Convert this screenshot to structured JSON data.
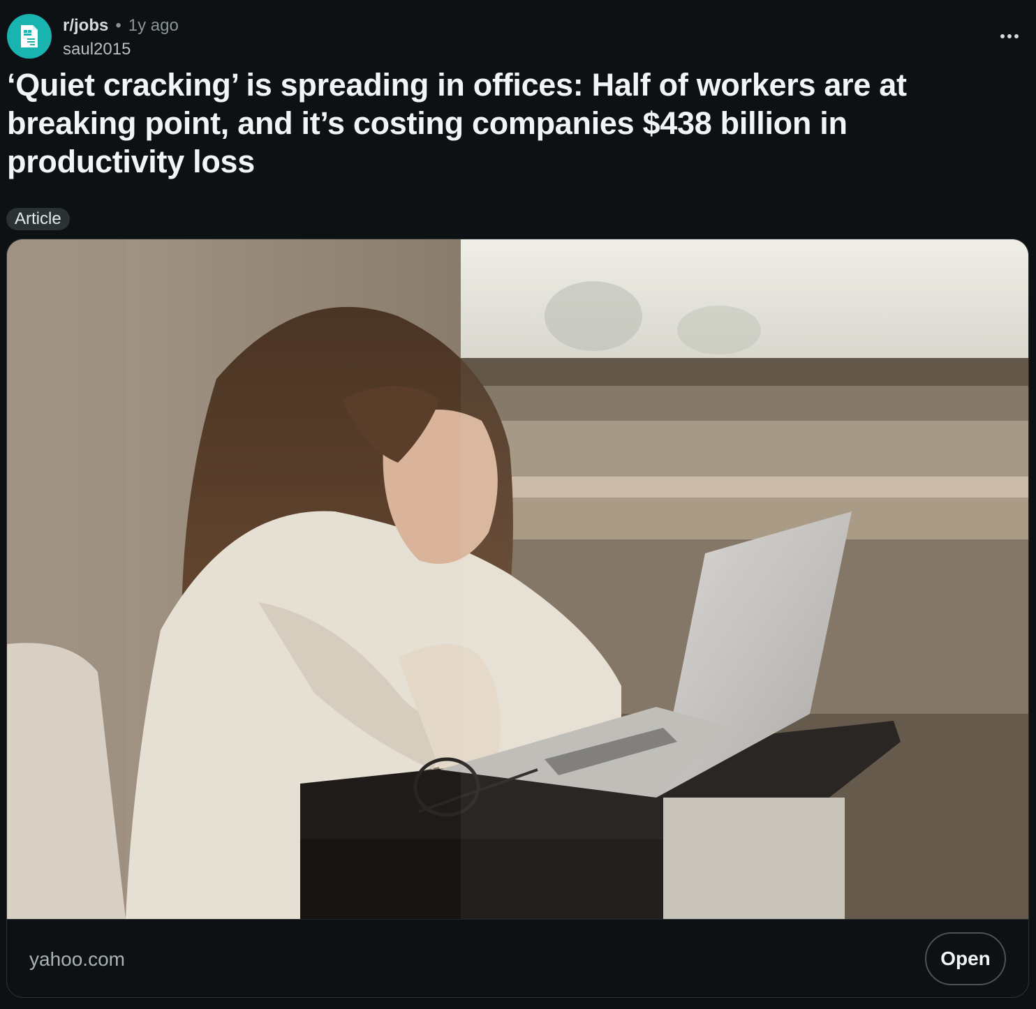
{
  "post": {
    "subreddit": "r/jobs",
    "separator": "•",
    "time": "1y ago",
    "author": "saul2015",
    "title": "‘Quiet cracking’ is spreading in offices: Half of workers are at breaking point, and it’s costing companies $438 billion in productivity loss",
    "flair": "Article"
  },
  "link_card": {
    "domain": "yahoo.com",
    "open_label": "Open"
  },
  "icons": {
    "avatar": "subreddit-document-icon",
    "menu": "more-options-icon"
  },
  "colors": {
    "background": "#0e1113",
    "avatar_bg": "#19b4b0",
    "flair_bg": "#2a3236",
    "muted_text": "#8b9499"
  }
}
